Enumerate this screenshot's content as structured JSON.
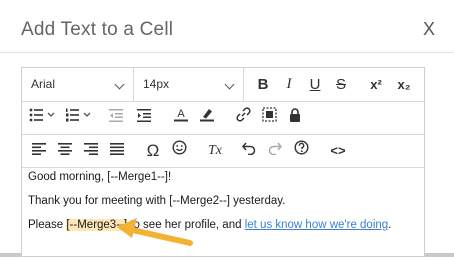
{
  "dialog": {
    "title": "Add Text to a Cell",
    "close_label": "X"
  },
  "toolbar": {
    "font_family": "Arial",
    "font_size": "14px",
    "bold": "B",
    "italic": "I",
    "underline": "U",
    "strikethrough": "S",
    "superscript": "x²",
    "subscript": "x₂",
    "omega": "Ω",
    "clear_format": "Tx",
    "source": "<>"
  },
  "content": {
    "line1": "Good morning, [--Merge1--]!",
    "line2": "Thank you for meeting with [--Merge2--] yesterday.",
    "line3_prefix": "Please ",
    "line3_merge": "[--Merge3--]",
    "line3_middle": " to see her profile, and ",
    "line3_link": "let us know how we're doing",
    "line3_suffix": "."
  },
  "colors": {
    "highlight": "#fde7b8",
    "arrow": "#f2b233",
    "link": "#3a7fd5"
  }
}
